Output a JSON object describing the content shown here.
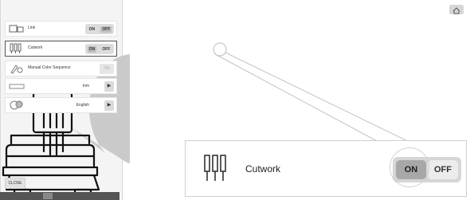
{
  "screen": {
    "rows": [
      {
        "label": "Link",
        "icon": "link-icon",
        "control": "toggle",
        "on": "ON",
        "off": "OFF"
      },
      {
        "label": "Cutwork",
        "icon": "cutwork-needles-icon",
        "control": "toggle",
        "on": "ON",
        "off": "OFF"
      },
      {
        "label": "Manual Color Sequence",
        "icon": "color-sequence-icon",
        "control": "disabled"
      },
      {
        "label": "",
        "icon": "ruler-icon",
        "control": "value",
        "value": "mm"
      },
      {
        "label": "",
        "icon": "language-icon",
        "control": "value",
        "value": "English"
      }
    ],
    "close_label": "CLOSE"
  },
  "zoom": {
    "label": "Cutwork",
    "on": "ON",
    "off": "OFF"
  },
  "colors": {
    "bubble": "#c9c9c9",
    "toggle_selected": "#a8a8a8"
  }
}
